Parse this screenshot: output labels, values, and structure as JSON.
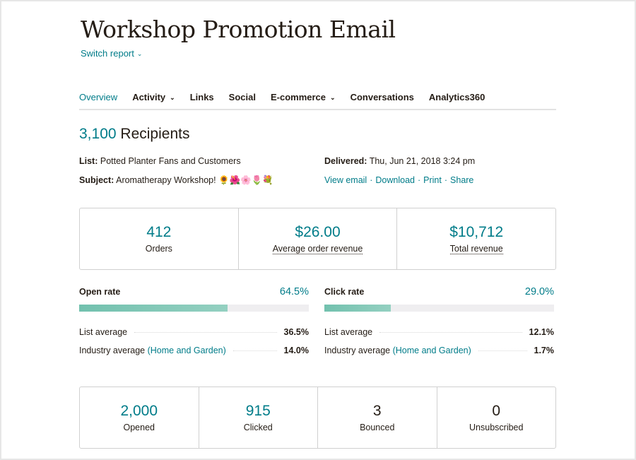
{
  "header": {
    "title": "Workshop Promotion Email",
    "switch_report": "Switch report"
  },
  "tabs": [
    {
      "label": "Overview",
      "active": true,
      "dropdown": false
    },
    {
      "label": "Activity",
      "active": false,
      "dropdown": true
    },
    {
      "label": "Links",
      "active": false,
      "dropdown": false
    },
    {
      "label": "Social",
      "active": false,
      "dropdown": false
    },
    {
      "label": "E-commerce",
      "active": false,
      "dropdown": true
    },
    {
      "label": "Conversations",
      "active": false,
      "dropdown": false
    },
    {
      "label": "Analytics360",
      "active": false,
      "dropdown": false
    }
  ],
  "summary": {
    "recipients_count": "3,100",
    "recipients_label": "Recipients",
    "list_label": "List:",
    "list_value": "Potted Planter Fans and Customers",
    "subject_label": "Subject:",
    "subject_value": "Aromatherapy Workshop! 🌻🌺🌸🌷💐",
    "delivered_label": "Delivered:",
    "delivered_value": "Thu, Jun 21, 2018 3:24 pm",
    "actions": [
      "View email",
      "Download",
      "Print",
      "Share"
    ]
  },
  "ecommerce": [
    {
      "value": "412",
      "label": "Orders",
      "dotted": false
    },
    {
      "value": "$26.00",
      "label": "Average order revenue",
      "dotted": true
    },
    {
      "value": "$10,712",
      "label": "Total revenue",
      "dotted": true
    }
  ],
  "open_rate": {
    "label": "Open rate",
    "value": "64.5%",
    "fill_percent": 64.5,
    "list_average_label": "List average",
    "list_average": "36.5%",
    "industry_label": "Industry average",
    "industry_name": "(Home and Garden)",
    "industry_average": "14.0%"
  },
  "click_rate": {
    "label": "Click rate",
    "value": "29.0%",
    "fill_percent": 29.0,
    "list_average_label": "List average",
    "list_average": "12.1%",
    "industry_label": "Industry average",
    "industry_name": "(Home and Garden)",
    "industry_average": "1.7%"
  },
  "stats": [
    {
      "value": "2,000",
      "label": "Opened",
      "accent": true
    },
    {
      "value": "915",
      "label": "Clicked",
      "accent": true
    },
    {
      "value": "3",
      "label": "Bounced",
      "accent": false
    },
    {
      "value": "0",
      "label": "Unsubscribed",
      "accent": false
    }
  ],
  "colors": {
    "accent": "#007c89",
    "bar_fill": "#72c1ae",
    "bar_track": "#efeef0"
  }
}
